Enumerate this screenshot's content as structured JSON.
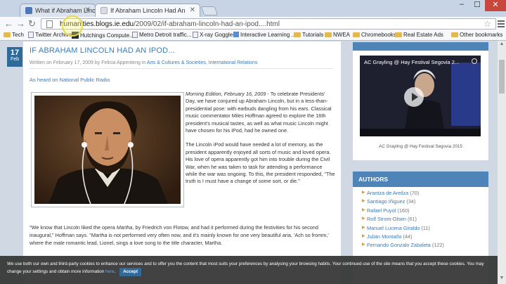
{
  "browser": {
    "tabs": [
      {
        "title": "What if Abraham Lincoln",
        "active": false
      },
      {
        "title": "If Abraham Lincoln Had An",
        "active": true
      }
    ],
    "url_host": "humanities.blogs.ie.edu",
    "url_path": "/2009/02/if-abraham-lincoln-had-an-ipod....html",
    "bookmarks": [
      {
        "label": "Tech",
        "icon": "folder-icon"
      },
      {
        "label": "Twitter Archives",
        "icon": "file-icon"
      },
      {
        "label": "Hutchings Compute...",
        "icon": "h-icon"
      },
      {
        "label": "Metro Detroit traffic...",
        "icon": "file-icon"
      },
      {
        "label": "X-ray Goggles",
        "icon": "file-icon"
      },
      {
        "label": "Interactive Learning ...",
        "icon": "blue-icon"
      },
      {
        "label": "Tutorials",
        "icon": "folder-icon"
      },
      {
        "label": "NWEA",
        "icon": "folder-icon"
      },
      {
        "label": "Chromebooks",
        "icon": "folder-icon"
      },
      {
        "label": "Real Estate Ads",
        "icon": "folder-icon"
      },
      {
        "label": "Other bookmarks",
        "icon": "folder-icon"
      }
    ]
  },
  "post": {
    "date_day": "17",
    "date_month": "Feb",
    "title": "IF ABRAHAM LINCOLN HAD AN IPOD...",
    "byline_prefix": "Written on February 17, 2009 by Felicia Appenteng in",
    "categories": "Arts & Cultures & Societies, International Relations",
    "heard_on": "As heard on National Public Radio",
    "intro_source": "Morning Edition, February 16, 2009",
    "intro_rest": " - To celebrate Presidents' Day, we have conjured up Abraham Lincoln, but in a less-than-presidential pose: with earbuds dangling from his ears. Classical music commentator Miles Hoffman agreed to explore the 16th president's musical tastes, as well as what music Lincoln might have chosen for his iPod, had he owned one.",
    "para2": "The Lincoln iPod would have needed a lot of memory, as the president apparently enjoyed all sorts of music and loved opera. His love of opera apparently got him into trouble during the Civil War, when he was taken to task for attending a performance while the war was ongoing. To this, the president responded, \"The truth is I must have a change of some sort, or die.\"",
    "para3_a": "\"We know that Lincoln liked the opera ",
    "para3_opera": "Martha",
    "para3_b": ", by Friedrich von Flotow, and had it performed during the festivities for his second inaugural,\" Hoffman says. \"",
    "para3_opera2": "Martha",
    "para3_c": " is not performed very often now, and it's mainly known for one very beautiful aria, 'Ach so fromm,' where the male romantic lead, Lionel, sings a love song to the title character, Martha."
  },
  "sidebar": {
    "video_title": "AC Grayling @ Hay Festival Segovia 2...",
    "video_caption": "AC Grayling @ Hay Festival Segovia 2015",
    "authors_heading": "AUTHORS",
    "authors": [
      {
        "name": "Arantza de Areilza",
        "count": "(70)"
      },
      {
        "name": "Santiago Iñiguez",
        "count": "(34)"
      },
      {
        "name": "Rafael Puyol",
        "count": "(160)"
      },
      {
        "name": "Rolf Strom-Olsen",
        "count": "(61)"
      },
      {
        "name": "Manuel Lucena Giraldo",
        "count": "(11)"
      },
      {
        "name": "Julián Montaño",
        "count": "(44)"
      },
      {
        "name": "Fernando Gonzalo Zabaleta",
        "count": "(122)"
      }
    ]
  },
  "cookie": {
    "text": "We use both our own and third-party cookies to enhance our services and to offer you the content that most suits your preferences by analysing your browsing habits. Your continued use of the site means that you accept these cookies. You may change your settings and obtain more information",
    "more_link": "here",
    "accept": "Accept"
  },
  "colors": {
    "accent": "#3c7ab8",
    "header_blue": "#4e84b8",
    "date_badge": "#2f6a98",
    "close_red": "#c9463d"
  }
}
